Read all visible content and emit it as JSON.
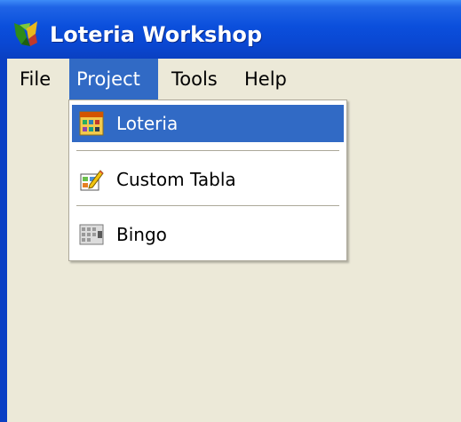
{
  "window": {
    "title": "Loteria Workshop",
    "icon": "rooster-icon"
  },
  "menubar": {
    "items": [
      {
        "label": "File"
      },
      {
        "label": "Project"
      },
      {
        "label": "Tools"
      },
      {
        "label": "Help"
      }
    ],
    "open_menu": "Project"
  },
  "project_menu": {
    "items": [
      {
        "label": "Loteria",
        "icon": "loteria-grid-icon",
        "highlighted": true
      },
      {
        "label": "Custom Tabla",
        "icon": "pencil-edit-icon",
        "highlighted": false
      },
      {
        "label": "Bingo",
        "icon": "bingo-card-icon",
        "highlighted": false
      }
    ]
  },
  "colors": {
    "titlebar": "#0a47d2",
    "highlight": "#316ac5",
    "menu_background": "#ece9d8",
    "dropdown_background": "#ffffff"
  }
}
